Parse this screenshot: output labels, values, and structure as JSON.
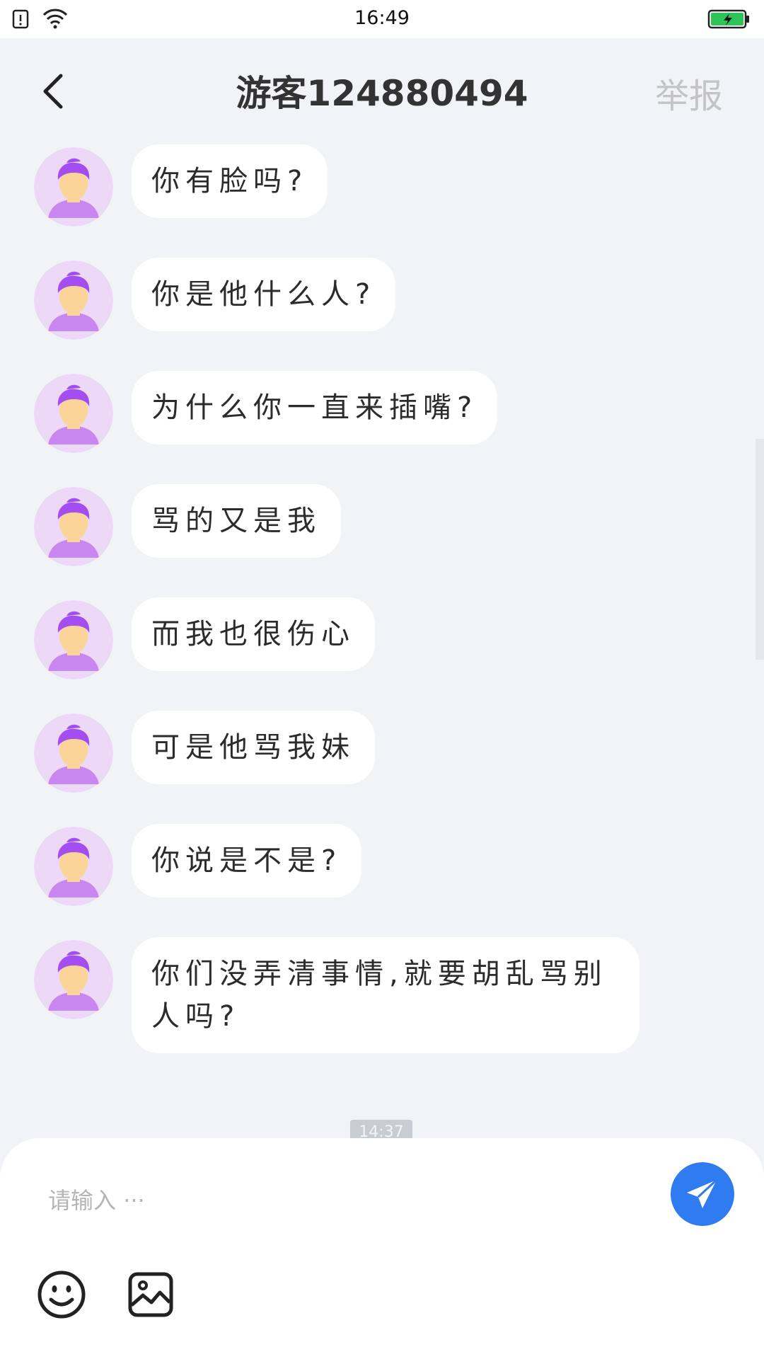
{
  "status_bar": {
    "time": "16:49"
  },
  "header": {
    "title": "游客124880494",
    "report_label": "举报"
  },
  "messages": [
    {
      "text": "你有脸吗?"
    },
    {
      "text": " 你是他什么人?"
    },
    {
      "text": "为什么你一直来插嘴?"
    },
    {
      "text": "骂的又是我"
    },
    {
      "text": "而我也很伤心"
    },
    {
      "text": "可是他骂我妹"
    },
    {
      "text": "你说是不是?"
    },
    {
      "text": " 你们没弄清事情,就要胡乱骂别人吗?"
    }
  ],
  "time_divider": "14:37",
  "composer": {
    "placeholder": "请输入 ···"
  },
  "icons": {
    "back": "back-chevron-icon",
    "send": "send-plane-icon",
    "emoji": "emoji-smile-icon",
    "image": "image-picture-icon"
  },
  "colors": {
    "background": "#f2f3f6",
    "send_button": "#2f7bf0",
    "report_text": "#c4c4c4",
    "avatar_bg": "#ecd9f7",
    "avatar_hair": "#a34ff0"
  }
}
